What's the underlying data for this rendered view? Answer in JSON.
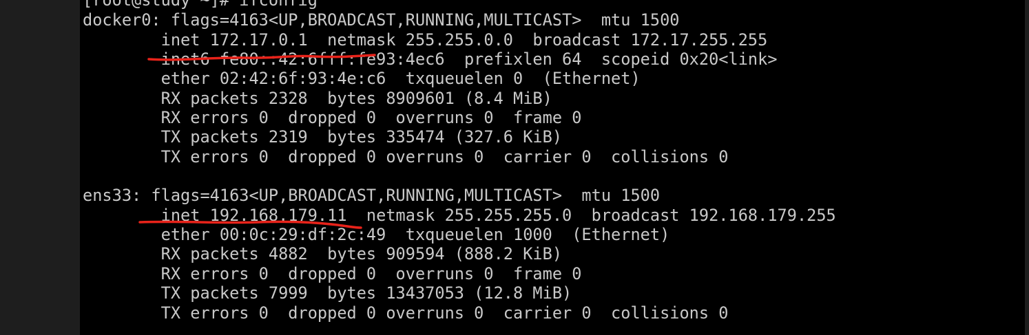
{
  "terminal": {
    "lines": [
      "[root@study ~]# ifconfig",
      "docker0: flags=4163<UP,BROADCAST,RUNNING,MULTICAST>  mtu 1500",
      "        inet 172.17.0.1  netmask 255.255.0.0  broadcast 172.17.255.255",
      "        inet6 fe80::42:6fff:fe93:4ec6  prefixlen 64  scopeid 0x20<link>",
      "        ether 02:42:6f:93:4e:c6  txqueuelen 0  (Ethernet)",
      "        RX packets 2328  bytes 8909601 (8.4 MiB)",
      "        RX errors 0  dropped 0  overruns 0  frame 0",
      "        TX packets 2319  bytes 335474 (327.6 KiB)",
      "        TX errors 0  dropped 0 overruns 0  carrier 0  collisions 0",
      "",
      "ens33: flags=4163<UP,BROADCAST,RUNNING,MULTICAST>  mtu 1500",
      "        inet 192.168.179.11  netmask 255.255.255.0  broadcast 192.168.179.255",
      "        ether 00:0c:29:df:2c:49  txqueuelen 1000  (Ethernet)",
      "        RX packets 4882  bytes 909594 (888.2 KiB)",
      "        RX errors 0  dropped 0  overruns 0  frame 0",
      "        TX packets 7999  bytes 13437053 (12.8 MiB)",
      "        TX errors 0  dropped 0 overruns 0  carrier 0  collisions 0"
    ]
  },
  "colors": {
    "terminal_background": "#000000",
    "terminal_text": "#c9c9c9",
    "window_chrome": "#1e1e1e",
    "annotation_underline": "#e8231a"
  }
}
